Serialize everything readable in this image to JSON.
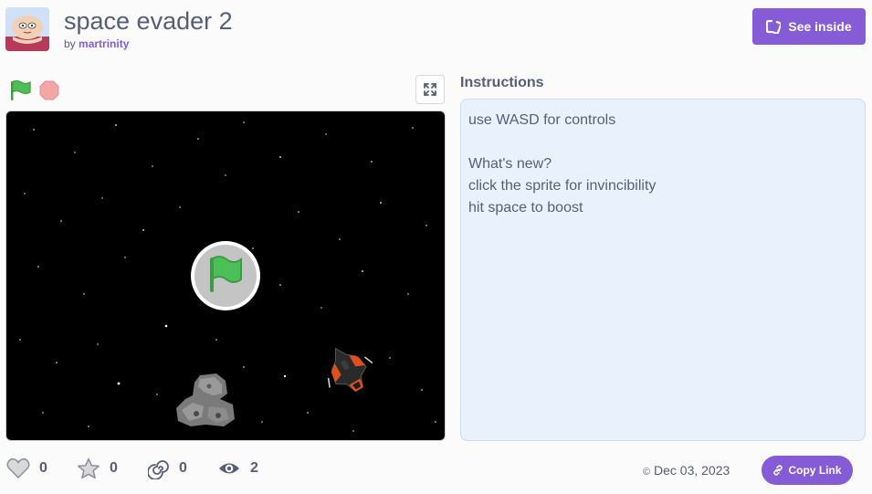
{
  "project": {
    "title": "space evader 2",
    "by_prefix": "by",
    "author": "martrinity"
  },
  "header": {
    "see_inside_label": "See inside"
  },
  "instructions": {
    "heading": "Instructions",
    "lines": [
      "use WASD for controls",
      "",
      "What's new?",
      "click the sprite for invincibility",
      "hit space to boost"
    ]
  },
  "stats": {
    "loves": "0",
    "favorites": "0",
    "remixes": "0",
    "views": "2"
  },
  "footer": {
    "date": "Dec 03, 2023",
    "copy_link_label": "Copy Link"
  },
  "icons": {
    "flag": "green-flag-icon",
    "stop": "stop-icon",
    "fullscreen": "fullscreen-icon",
    "see_inside": "see-inside-icon",
    "love": "heart-icon",
    "favorite": "star-icon",
    "remix": "remix-icon",
    "view": "eye-icon",
    "copy": "link-icon",
    "date": "copyright-icon"
  },
  "colors": {
    "accent": "#855cd6",
    "text": "#575e75",
    "flag_green": "#4cbf56",
    "stop_red": "#ec5959",
    "instructions_bg": "#e9f1fc"
  }
}
